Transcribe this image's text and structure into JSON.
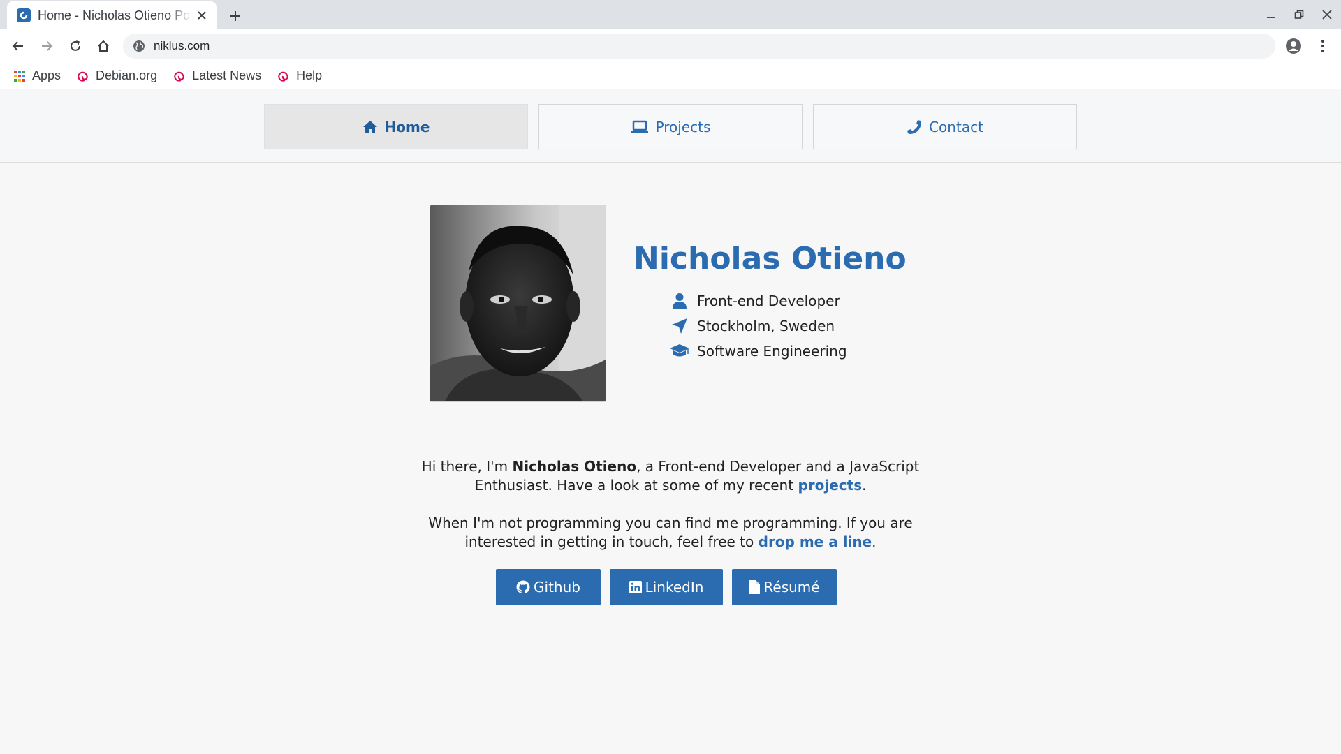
{
  "browser": {
    "tab_title": "Home - Nicholas Otieno Portfolio",
    "url": "niklus.com",
    "bookmarks": [
      {
        "label": "Apps",
        "icon": "apps-grid-icon"
      },
      {
        "label": "Debian.org",
        "icon": "debian-swirl-icon"
      },
      {
        "label": "Latest News",
        "icon": "debian-swirl-icon"
      },
      {
        "label": "Help",
        "icon": "debian-swirl-icon"
      }
    ]
  },
  "site_nav": {
    "items": [
      {
        "label": "Home",
        "icon": "home-icon",
        "active": true
      },
      {
        "label": "Projects",
        "icon": "laptop-icon",
        "active": false
      },
      {
        "label": "Contact",
        "icon": "phone-icon",
        "active": false
      }
    ]
  },
  "profile": {
    "name": "Nicholas Otieno",
    "facts": [
      {
        "text": "Front-end Developer",
        "icon": "user-icon"
      },
      {
        "text": "Stockholm, Sweden",
        "icon": "location-arrow-icon"
      },
      {
        "text": "Software Engineering",
        "icon": "graduation-cap-icon"
      }
    ]
  },
  "bio": {
    "p1_before": "Hi there, I'm ",
    "p1_name": "Nicholas Otieno",
    "p1_middle": ", a Front-end Developer and a JavaScript Enthusiast. Have a look at some of my recent ",
    "p1_link": "projects",
    "p1_after": ".",
    "p2_before": "When I'm not programming you can find me programming. If you are interested in getting in touch, feel free to ",
    "p2_link": "drop me a line",
    "p2_after": "."
  },
  "social": [
    {
      "label": "Github",
      "icon": "github-icon"
    },
    {
      "label": "LinkedIn",
      "icon": "linkedin-icon"
    },
    {
      "label": "Résumé",
      "icon": "file-icon"
    }
  ],
  "colors": {
    "accent": "#2b6cb0",
    "page_background": "#f7f7f7",
    "tabstrip": "#dee1e6"
  }
}
